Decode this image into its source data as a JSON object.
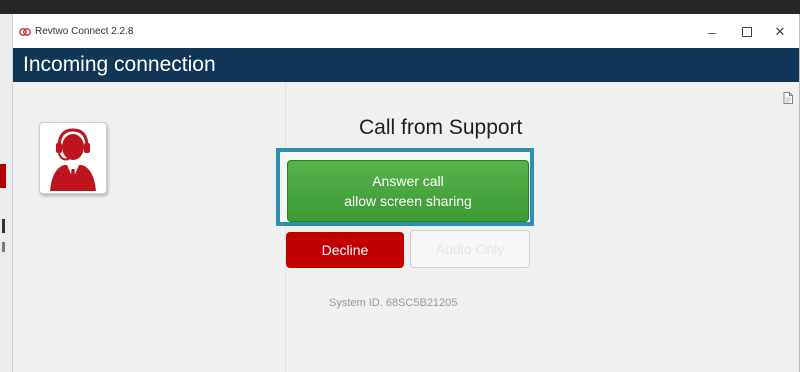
{
  "window": {
    "app_title": "Revtwo Connect 2.2.8",
    "controls": {
      "minimize": "–",
      "close": "✕"
    }
  },
  "header": {
    "title": "Incoming connection"
  },
  "call": {
    "from_text": "Call from Support",
    "answer_line1": "Answer call",
    "answer_line2": "allow screen sharing",
    "decline_label": "Decline",
    "audio_only_label": "Audio Only",
    "system_id": "System ID. 68SC5B21205"
  },
  "icons": {
    "app": "revtwo-logo-icon",
    "document": "document-icon",
    "avatar": "support-agent-headset-icon"
  },
  "colors": {
    "header_bg": "#0f3557",
    "answer_green": "#4aa83e",
    "highlight_blue": "#2b8fb0",
    "decline_red": "#c00000"
  }
}
